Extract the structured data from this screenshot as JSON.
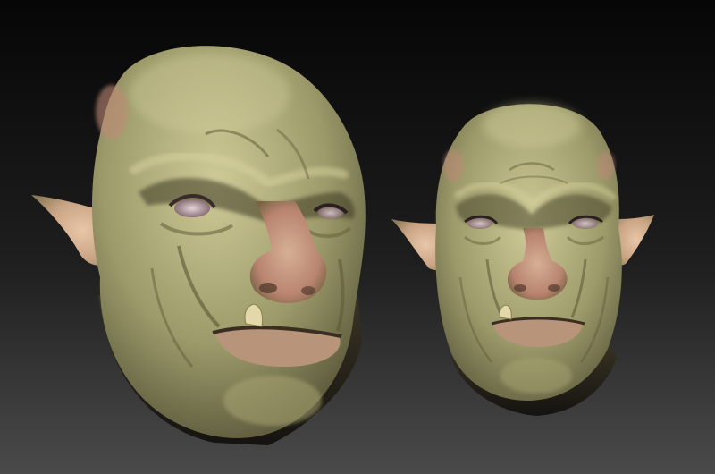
{
  "scene": {
    "background": {
      "top_color": "#060606",
      "mid_color": "#1e1e1e",
      "bottom_color": "#4a4a4a"
    },
    "skin": {
      "base": "#9c9a6a",
      "highlight": "#cfcb98",
      "shadow": "#4c4a30",
      "blush": "#b98470",
      "lip": "#b8957a"
    },
    "eye_color": "#e2d4da",
    "tusk_color": "#e3d8a8",
    "subjects": [
      {
        "name": "orc-head-three-quarter-view"
      },
      {
        "name": "orc-head-front-view"
      }
    ]
  }
}
